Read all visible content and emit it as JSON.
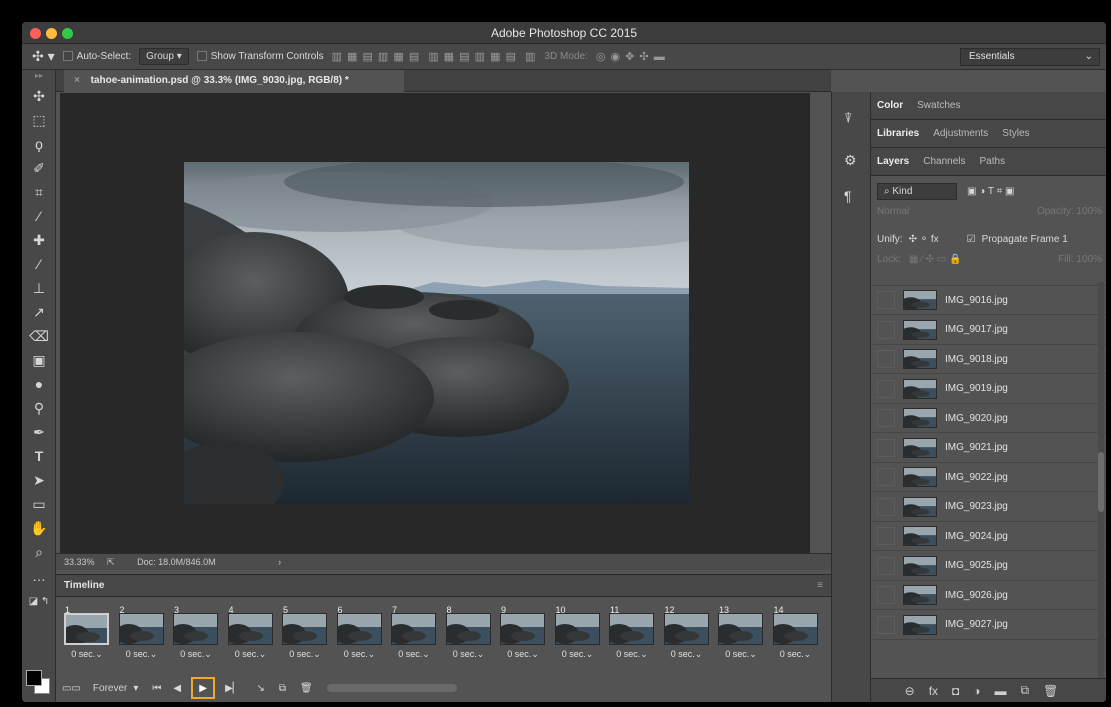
{
  "window": {
    "title": "Adobe Photoshop CC 2015"
  },
  "options_bar": {
    "auto_select_label": "Auto-Select:",
    "auto_select_value": "Group",
    "transform_label": "Show Transform Controls",
    "mode_label": "3D Mode:",
    "workspace": "Essentials"
  },
  "document": {
    "tab_title": "tahoe-animation.psd @ 33.3% (IMG_9030.jpg, RGB/8) *",
    "zoom": "33.33%",
    "doc_size": "Doc: 18.0M/846.0M"
  },
  "timeline": {
    "title": "Timeline",
    "loop": "Forever",
    "frames": [
      {
        "num": "1",
        "delay": "0 sec."
      },
      {
        "num": "2",
        "delay": "0 sec."
      },
      {
        "num": "3",
        "delay": "0 sec."
      },
      {
        "num": "4",
        "delay": "0 sec."
      },
      {
        "num": "5",
        "delay": "0 sec."
      },
      {
        "num": "6",
        "delay": "0 sec."
      },
      {
        "num": "7",
        "delay": "0 sec."
      },
      {
        "num": "8",
        "delay": "0 sec."
      },
      {
        "num": "9",
        "delay": "0 sec."
      },
      {
        "num": "10",
        "delay": "0 sec."
      },
      {
        "num": "11",
        "delay": "0 sec."
      },
      {
        "num": "12",
        "delay": "0 sec."
      },
      {
        "num": "13",
        "delay": "0 sec."
      },
      {
        "num": "14",
        "delay": "0 sec."
      }
    ],
    "selected_frame": "1",
    "highlight_color": "#f0a830"
  },
  "panels": {
    "row1": [
      "Color",
      "Swatches"
    ],
    "row2": [
      "Libraries",
      "Adjustments",
      "Styles"
    ],
    "row3": [
      "Layers",
      "Channels",
      "Paths"
    ],
    "filter_kind": "Kind",
    "blend_mode": "Normal",
    "opacity_label": "Opacity:",
    "opacity_value": "100%",
    "unify_label": "Unify:",
    "propagate_label": "Propagate Frame 1",
    "lock_label": "Lock:",
    "fill_label": "Fill:",
    "fill_value": "100%"
  },
  "layers": [
    "IMG_9016.jpg",
    "IMG_9017.jpg",
    "IMG_9018.jpg",
    "IMG_9019.jpg",
    "IMG_9020.jpg",
    "IMG_9021.jpg",
    "IMG_9022.jpg",
    "IMG_9023.jpg",
    "IMG_9024.jpg",
    "IMG_9025.jpg",
    "IMG_9026.jpg",
    "IMG_9027.jpg"
  ],
  "tools": [
    "move-icon",
    "marquee-icon",
    "lasso-icon",
    "quick-select-icon",
    "crop-icon",
    "eyedropper-icon",
    "healing-brush-icon",
    "brush-icon",
    "clone-stamp-icon",
    "history-brush-icon",
    "eraser-icon",
    "gradient-icon",
    "blur-icon",
    "dodge-icon",
    "pen-icon",
    "type-icon",
    "path-select-icon",
    "rectangle-icon",
    "hand-icon",
    "zoom-icon",
    "more-tools-icon"
  ]
}
